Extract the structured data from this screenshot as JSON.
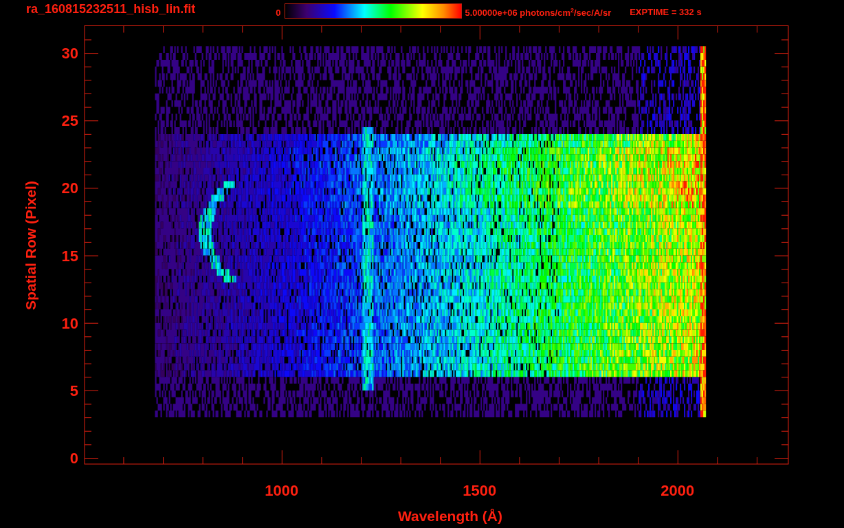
{
  "title": "ra_160815232511_hisb_lin.fit",
  "colorbar": {
    "min_label": "0",
    "max_label": "5.00000e+06 photons/cm$^{2}$/sec/A/sr"
  },
  "exposure": "EXPTIME = 332 s",
  "plot": {
    "x_axis": {
      "title": "Wavelength (Å)",
      "tick_labels": [
        "1000",
        "1500",
        "2000"
      ]
    },
    "y_axis": {
      "title": "Spatial Row (Pixel)",
      "tick_labels": [
        "30",
        "25",
        "20",
        "15",
        "10",
        "5",
        "0"
      ]
    }
  }
}
